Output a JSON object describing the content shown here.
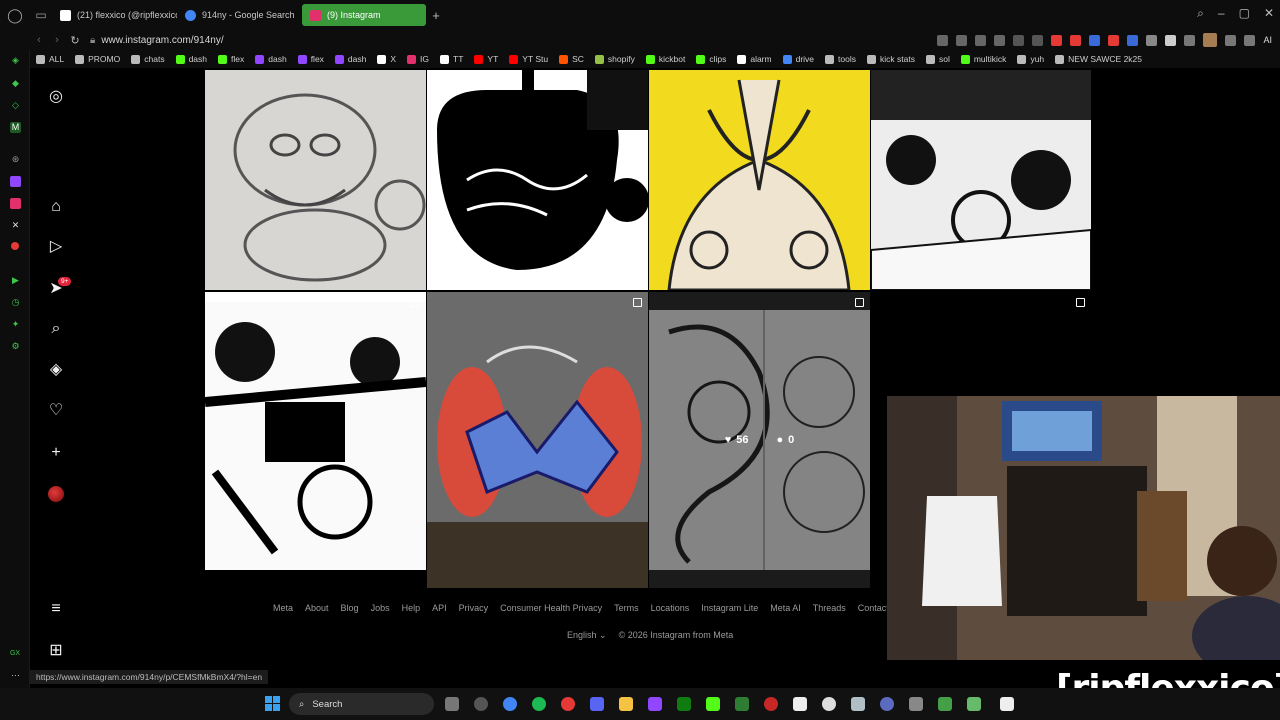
{
  "browser": {
    "tabs": [
      {
        "label": "(21) flexxico (@ripflexxico",
        "favicon_color": "#ffffff",
        "active": false
      },
      {
        "label": "914ny - Google Search",
        "favicon_color": "#4285f4",
        "active": false
      },
      {
        "label": "(9) Instagram",
        "favicon_color": "#e1306c",
        "active": true
      }
    ],
    "url": "www.instagram.com/914ny/",
    "ai_label": "AI",
    "bookmarks": [
      {
        "label": "ALL",
        "icon_color": "#bbbbbb"
      },
      {
        "label": "PROMO",
        "icon_color": "#bbbbbb"
      },
      {
        "label": "chats",
        "icon_color": "#bbbbbb"
      },
      {
        "label": "dash",
        "icon_color": "#53fc18"
      },
      {
        "label": "flex",
        "icon_color": "#53fc18"
      },
      {
        "label": "dash",
        "icon_color": "#9146ff"
      },
      {
        "label": "flex",
        "icon_color": "#9146ff"
      },
      {
        "label": "dash",
        "icon_color": "#9146ff"
      },
      {
        "label": "X",
        "icon_color": "#ffffff"
      },
      {
        "label": "IG",
        "icon_color": "#e1306c"
      },
      {
        "label": "TT",
        "icon_color": "#ffffff"
      },
      {
        "label": "YT",
        "icon_color": "#ff0000"
      },
      {
        "label": "YT Stu",
        "icon_color": "#ff0000"
      },
      {
        "label": "SC",
        "icon_color": "#ff5500"
      },
      {
        "label": "shopify",
        "icon_color": "#95bf47"
      },
      {
        "label": "kickbot",
        "icon_color": "#53fc18"
      },
      {
        "label": "clips",
        "icon_color": "#53fc18"
      },
      {
        "label": "alarm",
        "icon_color": "#ffffff"
      },
      {
        "label": "drive",
        "icon_color": "#4285f4"
      },
      {
        "label": "tools",
        "icon_color": "#bbbbbb"
      },
      {
        "label": "kick stats",
        "icon_color": "#bbbbbb"
      },
      {
        "label": "sol",
        "icon_color": "#bbbbbb"
      },
      {
        "label": "multikick",
        "icon_color": "#53fc18"
      },
      {
        "label": "yuh",
        "icon_color": "#bbbbbb"
      },
      {
        "label": "NEW SAWCE 2k25",
        "icon_color": "#bbbbbb"
      }
    ],
    "status_url": "https://www.instagram.com/914ny/p/CEMSfMkBmX4/?hl=en"
  },
  "instagram": {
    "nav": [
      {
        "name": "instagram-logo-icon",
        "glyph": "◎"
      },
      {
        "name": "home-icon",
        "glyph": "⌂"
      },
      {
        "name": "reels-icon",
        "glyph": "▶"
      },
      {
        "name": "messages-icon",
        "glyph": "➤"
      },
      {
        "name": "search-icon",
        "glyph": "⌕"
      },
      {
        "name": "explore-icon",
        "glyph": "◈"
      },
      {
        "name": "notifications-icon",
        "glyph": "♡"
      },
      {
        "name": "create-icon",
        "glyph": "+"
      },
      {
        "name": "profile-avatar",
        "glyph": ""
      },
      {
        "name": "more-menu-icon",
        "glyph": "≡"
      },
      {
        "name": "also-from-meta-icon",
        "glyph": "⊞"
      }
    ],
    "messages_badge": "9+",
    "hover_stats": {
      "likes": "56",
      "comments": "0"
    },
    "footer_links": [
      "Meta",
      "About",
      "Blog",
      "Jobs",
      "Help",
      "API",
      "Privacy",
      "Consumer Health Privacy",
      "Terms",
      "Locations",
      "Instagram Lite",
      "Meta AI",
      "Threads",
      "Contact Uplo"
    ],
    "language": "English",
    "copyright": "© 2026 Instagram from Meta"
  },
  "overlay": {
    "channel_name": "[ripflexxico]"
  },
  "taskbar": {
    "search_placeholder": "Search"
  }
}
